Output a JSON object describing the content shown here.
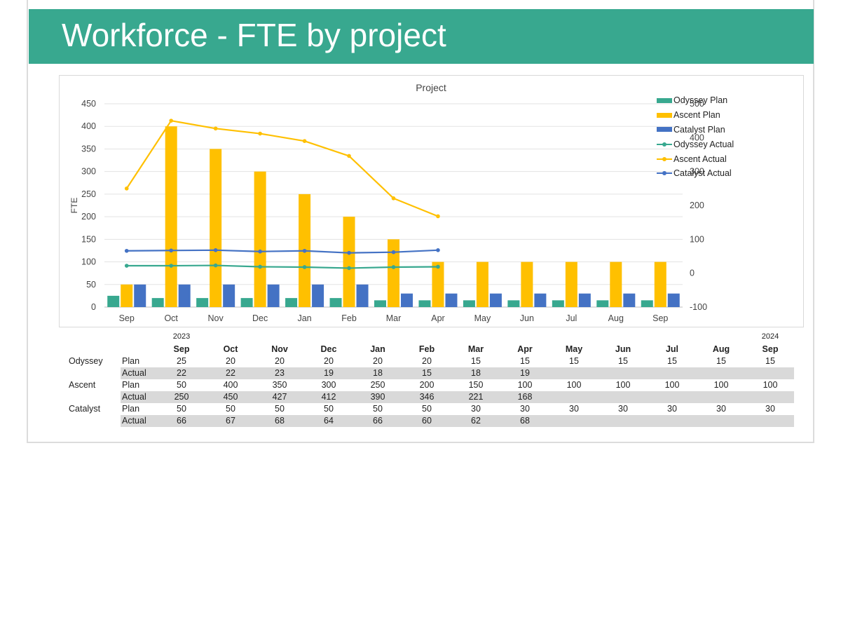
{
  "page": {
    "title": "Workforce - FTE by project"
  },
  "colors": {
    "banner": "#38a88f",
    "odyssey": "#38a88f",
    "ascent": "#ffc000",
    "catalyst": "#4472c4"
  },
  "chart_data": {
    "type": "bar",
    "title": "Project",
    "ylabel": "FTE",
    "ylim": [
      0,
      450
    ],
    "y2lim": [
      -100,
      500
    ],
    "yticks": [
      0,
      50,
      100,
      150,
      200,
      250,
      300,
      350,
      400,
      450
    ],
    "y2ticks": [
      -100,
      0,
      100,
      200,
      300,
      400,
      500
    ],
    "categories": [
      "Sep",
      "Oct",
      "Nov",
      "Dec",
      "Jan",
      "Feb",
      "Mar",
      "Apr",
      "May",
      "Jun",
      "Jul",
      "Aug",
      "Sep"
    ],
    "legend_position": "right",
    "series": [
      {
        "name": "Odyssey Plan",
        "kind": "bar",
        "axis": "left",
        "color": "#38a88f",
        "values": [
          25,
          20,
          20,
          20,
          20,
          20,
          15,
          15,
          15,
          15,
          15,
          15,
          15
        ]
      },
      {
        "name": "Ascent Plan",
        "kind": "bar",
        "axis": "left",
        "color": "#ffc000",
        "values": [
          50,
          400,
          350,
          300,
          250,
          200,
          150,
          100,
          100,
          100,
          100,
          100,
          100
        ]
      },
      {
        "name": "Catalyst Plan",
        "kind": "bar",
        "axis": "left",
        "color": "#4472c4",
        "values": [
          50,
          50,
          50,
          50,
          50,
          50,
          30,
          30,
          30,
          30,
          30,
          30,
          30
        ]
      },
      {
        "name": "Odyssey Actual",
        "kind": "line",
        "axis": "right",
        "color": "#38a88f",
        "values": [
          22,
          22,
          23,
          19,
          18,
          15,
          18,
          19
        ]
      },
      {
        "name": "Ascent Actual",
        "kind": "line",
        "axis": "right",
        "color": "#ffc000",
        "values": [
          250,
          450,
          427,
          412,
          390,
          346,
          221,
          168
        ]
      },
      {
        "name": "Catalyst Actual",
        "kind": "line",
        "axis": "right",
        "color": "#4472c4",
        "values": [
          66,
          67,
          68,
          64,
          66,
          60,
          62,
          68
        ]
      }
    ]
  },
  "table": {
    "year_start": "2023",
    "year_end": "2024",
    "months": [
      "Sep",
      "Oct",
      "Nov",
      "Dec",
      "Jan",
      "Feb",
      "Mar",
      "Apr",
      "May",
      "Jun",
      "Jul",
      "Aug",
      "Sep"
    ],
    "rows": [
      {
        "project": "Odyssey",
        "kind": "Plan",
        "values": [
          "25",
          "20",
          "20",
          "20",
          "20",
          "20",
          "15",
          "15",
          "15",
          "15",
          "15",
          "15",
          "15"
        ]
      },
      {
        "project": "",
        "kind": "Actual",
        "values": [
          "22",
          "22",
          "23",
          "19",
          "18",
          "15",
          "18",
          "19"
        ]
      },
      {
        "project": "Ascent",
        "kind": "Plan",
        "values": [
          "50",
          "400",
          "350",
          "300",
          "250",
          "200",
          "150",
          "100",
          "100",
          "100",
          "100",
          "100",
          "100"
        ]
      },
      {
        "project": "",
        "kind": "Actual",
        "values": [
          "250",
          "450",
          "427",
          "412",
          "390",
          "346",
          "221",
          "168"
        ]
      },
      {
        "project": "Catalyst",
        "kind": "Plan",
        "values": [
          "50",
          "50",
          "50",
          "50",
          "50",
          "50",
          "30",
          "30",
          "30",
          "30",
          "30",
          "30",
          "30"
        ]
      },
      {
        "project": "",
        "kind": "Actual",
        "values": [
          "66",
          "67",
          "68",
          "64",
          "66",
          "60",
          "62",
          "68"
        ]
      }
    ]
  }
}
